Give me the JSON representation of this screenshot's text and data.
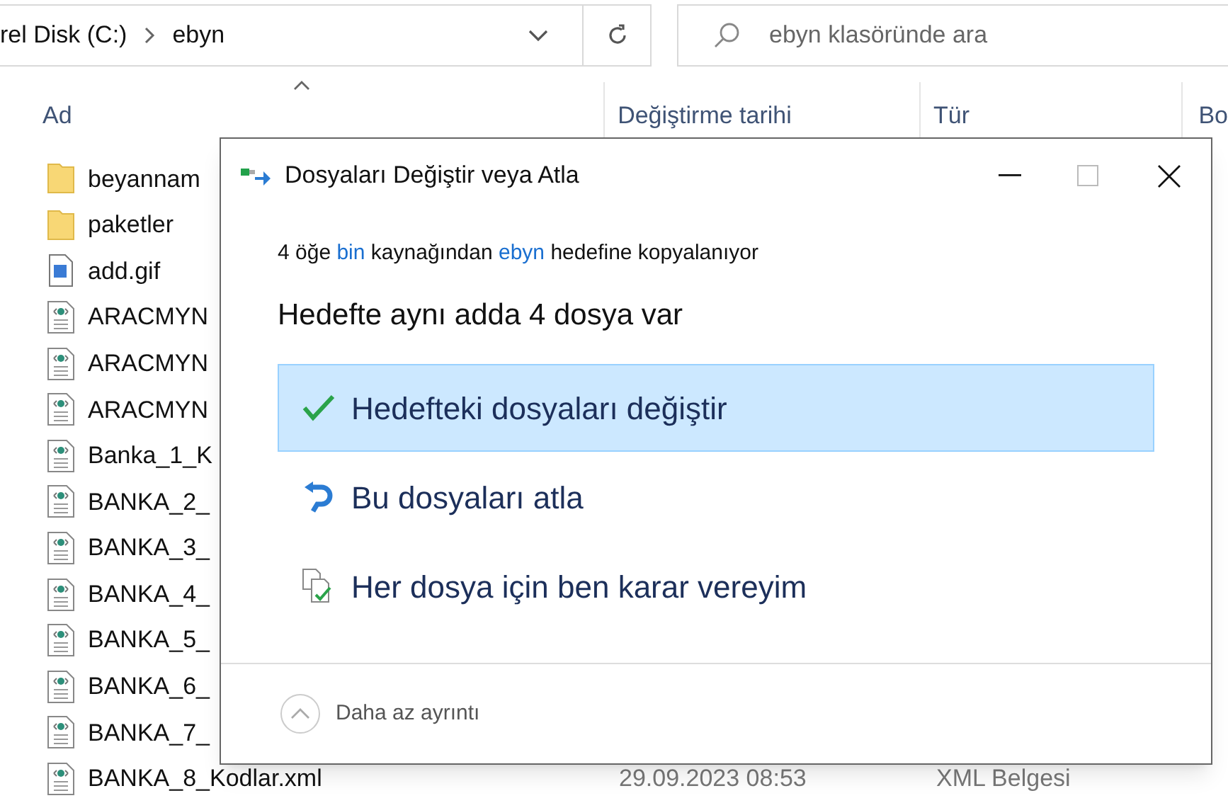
{
  "address_bar": {
    "path": [
      {
        "label": "rel Disk (C:)"
      },
      {
        "label": "ebyn"
      }
    ]
  },
  "search": {
    "placeholder": "ebyn klasöründe ara"
  },
  "columns": [
    {
      "label": "Ad",
      "sorted": true
    },
    {
      "label": "Değiştirme tarihi",
      "sorted": false
    },
    {
      "label": "Tür",
      "sorted": false
    },
    {
      "label": "Bo",
      "sorted": false
    }
  ],
  "files": [
    {
      "name": "beyannam",
      "kind": "folder"
    },
    {
      "name": "paketler",
      "kind": "folder"
    },
    {
      "name": "add.gif",
      "kind": "image"
    },
    {
      "name": "ARACMYN",
      "kind": "xml"
    },
    {
      "name": "ARACMYN",
      "kind": "xml"
    },
    {
      "name": "ARACMYN",
      "kind": "xml"
    },
    {
      "name": "Banka_1_K",
      "kind": "xml"
    },
    {
      "name": "BANKA_2_",
      "kind": "xml"
    },
    {
      "name": "BANKA_3_",
      "kind": "xml"
    },
    {
      "name": "BANKA_4_",
      "kind": "xml"
    },
    {
      "name": "BANKA_5_",
      "kind": "xml"
    },
    {
      "name": "BANKA_6_",
      "kind": "xml"
    },
    {
      "name": "BANKA_7_",
      "kind": "xml"
    },
    {
      "name": "BANKA_8_Kodlar.xml",
      "kind": "xml",
      "date": "29.09.2023 08:53",
      "type": "XML Belgesi"
    }
  ],
  "dialog": {
    "title": "Dosyaları Değiştir veya Atla",
    "subtitle": [
      {
        "text": "4 öğe ",
        "kind": "plain"
      },
      {
        "text": "bin",
        "kind": "link"
      },
      {
        "text": " kaynağından ",
        "kind": "plain"
      },
      {
        "text": "ebyn",
        "kind": "link"
      },
      {
        "text": " hedefine kopyalanıyor",
        "kind": "plain"
      }
    ],
    "heading": "Hedefte aynı adda 4 dosya var",
    "options": [
      {
        "label": "Hedefteki dosyaları değiştir",
        "kind": "replace",
        "selected": true
      },
      {
        "label": "Bu dosyaları atla",
        "kind": "skip",
        "selected": false
      },
      {
        "label": "Her dosya için ben karar vereyim",
        "kind": "decide",
        "selected": false
      }
    ],
    "details_toggle": "Daha az ayrıntı"
  }
}
